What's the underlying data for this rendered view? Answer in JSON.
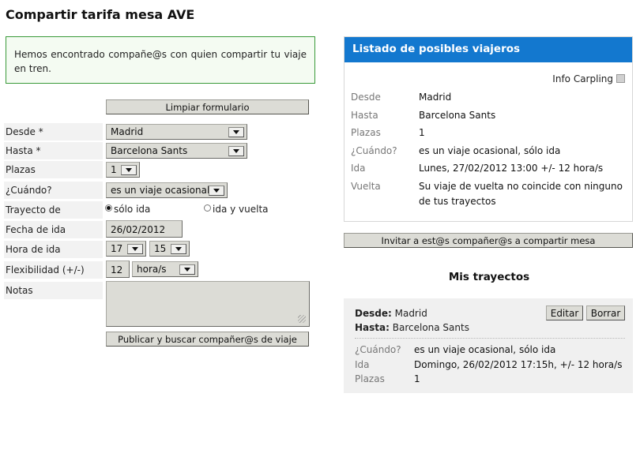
{
  "page": {
    "title": "Compartir tarifa mesa AVE"
  },
  "notice": {
    "text": "Hemos encontrado compañe@s con quien compartir tu viaje en tren."
  },
  "form": {
    "clear_label": "Limpiar formulario",
    "fields": {
      "desde": {
        "label": "Desde *",
        "value": "Madrid"
      },
      "hasta": {
        "label": "Hasta *",
        "value": "Barcelona Sants"
      },
      "plazas": {
        "label": "Plazas",
        "value": "1"
      },
      "cuando": {
        "label": "¿Cuándo?",
        "value": "es un viaje ocasional"
      },
      "trayecto": {
        "label": "Trayecto de",
        "option_one_way": "sólo ida",
        "option_round": "ida y vuelta",
        "selected": "sólo ida"
      },
      "fecha": {
        "label": "Fecha de ida",
        "value": "26/02/2012"
      },
      "hora": {
        "label": "Hora de ida",
        "hour": "17",
        "minute": "15"
      },
      "flex": {
        "label": "Flexibilidad (+/-)",
        "value": "12",
        "unit": "hora/s"
      },
      "notas": {
        "label": "Notas",
        "value": ""
      }
    },
    "submit_label": "Publicar y buscar compañer@s de viaje"
  },
  "travelers_panel": {
    "title": "Listado de posibles viajeros",
    "info_label": "Info Carpling",
    "rows": [
      {
        "label": "Desde",
        "value": "Madrid"
      },
      {
        "label": "Hasta",
        "value": "Barcelona Sants"
      },
      {
        "label": "Plazas",
        "value": "1"
      },
      {
        "label": "¿Cuándo?",
        "value": "es un viaje ocasional, sólo ida"
      },
      {
        "label": "Ida",
        "value": "Lunes, 27/02/2012 13:00 +/- 12 hora/s"
      },
      {
        "label": "Vuelta",
        "value": "Su viaje de vuelta no coincide con ninguno de tus trayectos"
      }
    ],
    "invite_label": "Invitar a est@s compañer@s a compartir mesa"
  },
  "my_trips": {
    "title": "Mis trayectos",
    "trip": {
      "desde_label": "Desde:",
      "desde_value": "Madrid",
      "hasta_label": "Hasta:",
      "hasta_value": "Barcelona Sants",
      "edit_label": "Editar",
      "delete_label": "Borrar",
      "rows": [
        {
          "label": "¿Cuándo?",
          "value": "es un viaje ocasional, sólo ida"
        },
        {
          "label": "Ida",
          "value": "Domingo, 26/02/2012 17:15h, +/- 12 hora/s"
        },
        {
          "label": "Plazas",
          "value": "1"
        }
      ]
    }
  }
}
